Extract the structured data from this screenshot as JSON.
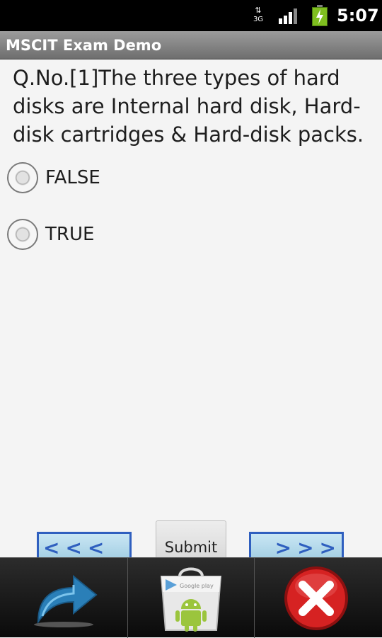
{
  "status_bar": {
    "network_label": "3G",
    "clock": "5:07",
    "icons": [
      "data-arrows-icon",
      "signal-icon",
      "battery-charging-icon"
    ]
  },
  "app": {
    "title": "MSCIT Exam Demo"
  },
  "question": {
    "text": "Q.No.[1]The three types of hard disks are Internal hard disk, Hard-disk cartridges & Hard-disk packs.",
    "options": [
      {
        "label": "FALSE",
        "selected": false
      },
      {
        "label": "TRUE",
        "selected": false
      }
    ]
  },
  "navigation": {
    "prev_label": "<<<",
    "next_label": ">>>",
    "submit_label": "Submit"
  },
  "dock": {
    "icons": [
      "share-arrow-icon",
      "google-play-store-icon",
      "close-icon"
    ],
    "colors": {
      "close_red": "#d62222",
      "arrow_blue": "#2a7fb8",
      "android_green": "#9bc53d"
    }
  }
}
